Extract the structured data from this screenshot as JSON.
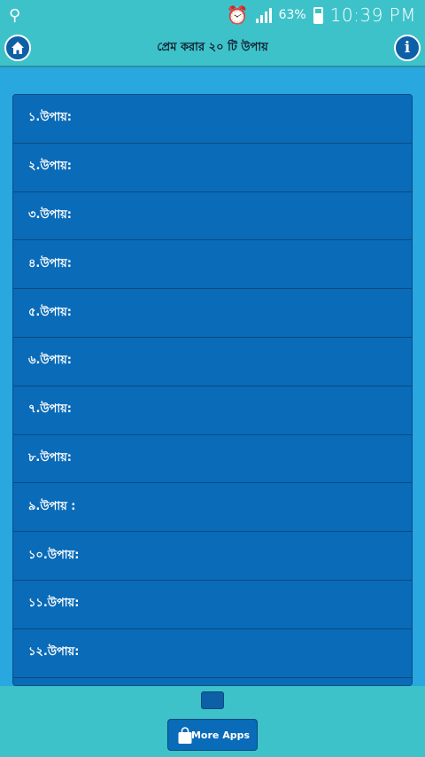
{
  "status": {
    "usb_icon": "usb-icon",
    "alarm_icon": "alarm-clock-icon",
    "signal_icon": "signal-bars-icon",
    "battery_percent": "63%",
    "battery_icon": "battery-charging-icon",
    "time": "10:39 PM"
  },
  "app_bar": {
    "title": "প্রেম করার ২০ টি উপায়",
    "home_icon": "home-icon",
    "info_icon": "info-icon",
    "info_glyph": "i"
  },
  "list": {
    "items": [
      "১.উপায়:",
      "২.উপায়:",
      "৩.উপায়:",
      "৪.উপায়:",
      "৫.উপায়:",
      "৬.উপায়:",
      "৭.উপায়:",
      "৮.উপায়:",
      "৯.উপায় :",
      "১০.উপায়:",
      "১১.উপায়:",
      "১২.উপায়:"
    ]
  },
  "bottom": {
    "more_apps_label": "More Apps",
    "bag_icon": "shopping-bag-icon"
  },
  "colors": {
    "bar": "#3ec2c9",
    "background": "#29a7df",
    "row": "#0a6bb8",
    "accent_dark": "#0d5fa6"
  }
}
